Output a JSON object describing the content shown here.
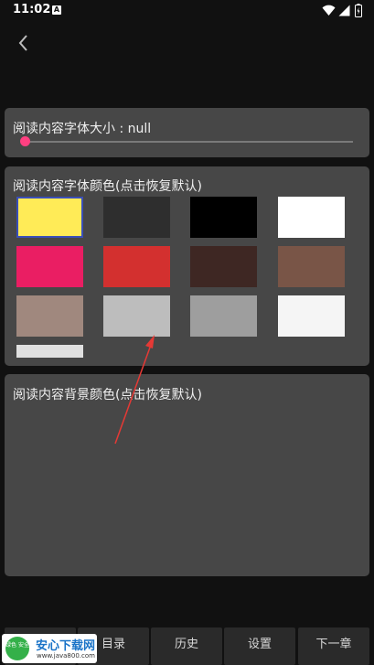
{
  "status_bar": {
    "time": "11:02",
    "notification_glyph": "A",
    "icons": [
      "notification-icon",
      "wifi-icon",
      "signal-icon",
      "battery-icon"
    ]
  },
  "toolbar": {
    "back_icon": "chevron-left-icon"
  },
  "font_size_panel": {
    "title": "阅读内容字体大小 : null",
    "slider_value": 0
  },
  "font_color_panel": {
    "title": "阅读内容字体颜色(点击恢复默认)",
    "selected_index": 0,
    "swatches": [
      "#ffeb57",
      "#2e2e2e",
      "#000000",
      "#ffffff",
      "#ea1e63",
      "#d3302f",
      "#3e2723",
      "#795547",
      "#a0887e",
      "#bdbdbd",
      "#9e9e9e",
      "#f5f5f5",
      "#e0e0e0"
    ]
  },
  "bg_color_panel": {
    "title": "阅读内容背景颜色(点击恢复默认)"
  },
  "annotation": {
    "arrow_color": "#e53935"
  },
  "bottom_nav": {
    "items": [
      "目录",
      "历史",
      "设置",
      "下一章"
    ]
  },
  "watermark": {
    "logo_text": "绿色 安全",
    "title": "安心下载网",
    "url": "www.java800.com"
  },
  "colors": {
    "background": "#111111",
    "panel": "#474747",
    "accent": "#ff4081"
  }
}
